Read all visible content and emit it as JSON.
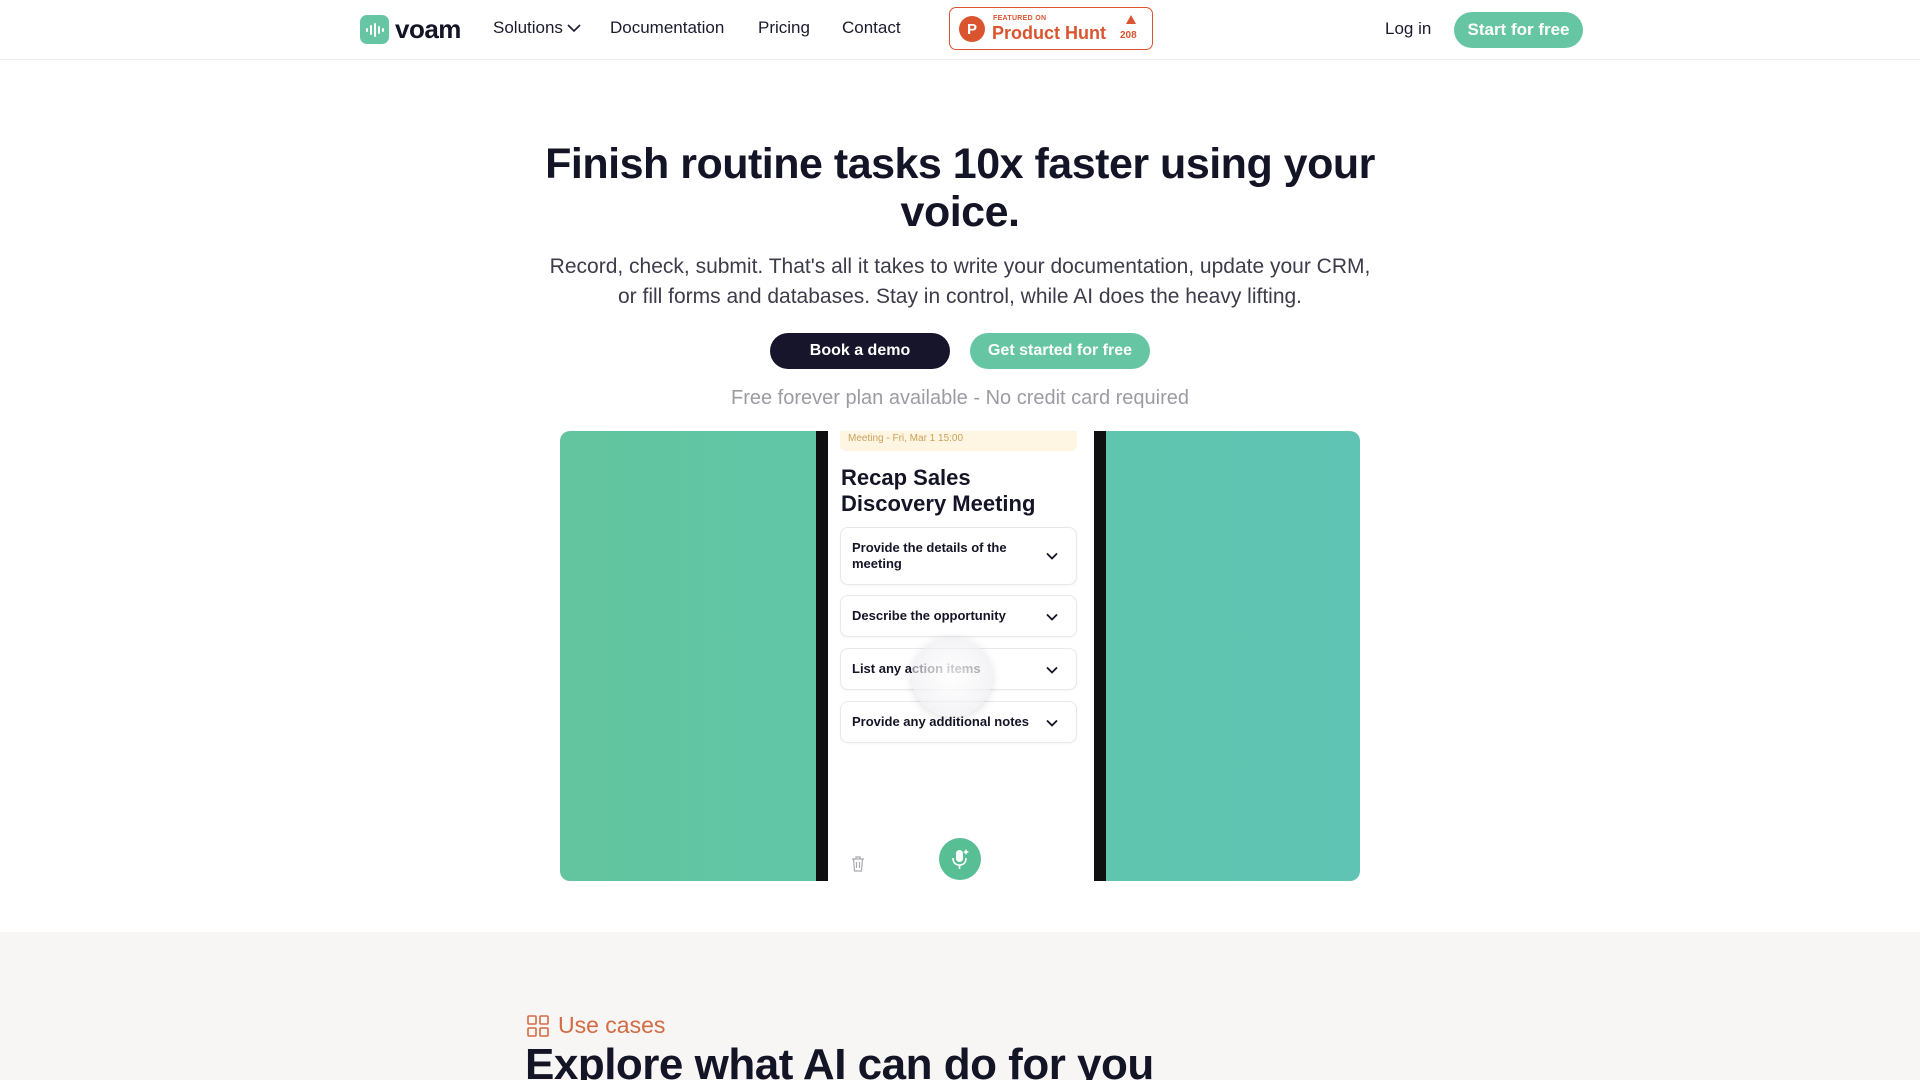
{
  "nav": {
    "logo_text": "voam",
    "links": {
      "solutions": "Solutions",
      "documentation": "Documentation",
      "pricing": "Pricing",
      "contact": "Contact"
    },
    "product_hunt": {
      "featured": "FEATURED ON",
      "name": "Product Hunt",
      "count": "208"
    },
    "login": "Log in",
    "start": "Start for free"
  },
  "hero": {
    "title": "Finish routine tasks 10x faster using your voice.",
    "subtitle": "Record, check, submit. That's all it takes to write your documentation, update your CRM, or fill forms and databases. Stay in control, while AI does the heavy lifting.",
    "book_demo": "Book a demo",
    "get_started": "Get started for free",
    "note": "Free forever plan available - No credit card required"
  },
  "preview": {
    "meeting_tag": "Meeting - Fri, Mar 1 15:00",
    "title": "Recap Sales Discovery Meeting",
    "items": [
      "Provide the details of the meeting",
      "Describe the opportunity",
      "List any action items",
      "Provide any additional notes"
    ]
  },
  "use_cases": {
    "label": "Use cases",
    "heading": "Explore what AI can do for you"
  },
  "colors": {
    "brand_green": "#66c6a3",
    "dark": "#17152b",
    "product_hunt": "#da552f",
    "accent_orange": "#d36b44"
  }
}
